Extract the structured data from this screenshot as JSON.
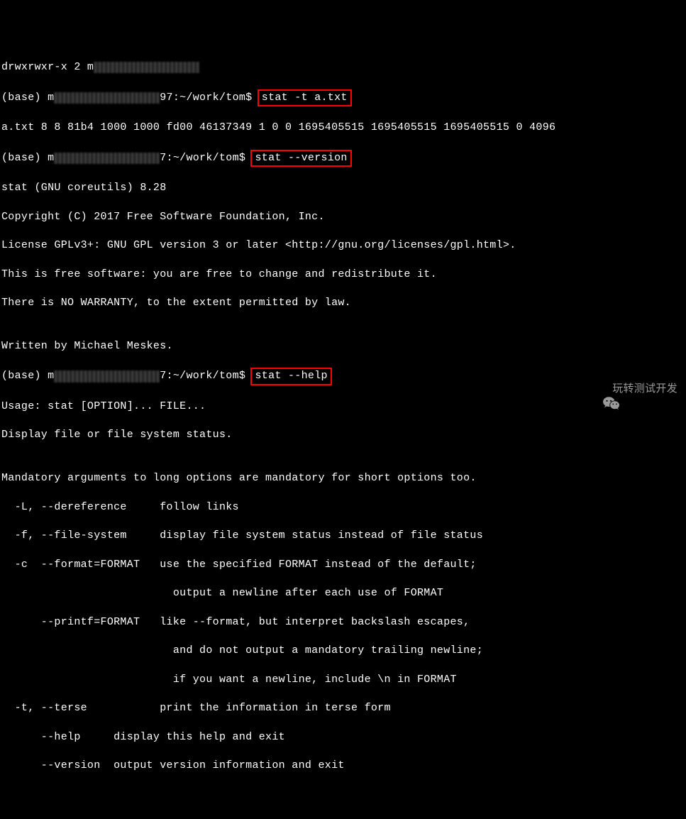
{
  "lines": {
    "l0_prefix": "drwxrwxr-x 2 m",
    "l0_suffix": "                                        ",
    "l1_prefix": "(base) m",
    "l1_mid": "97:~/work/tom$ ",
    "l1_cmd": "stat -t a.txt",
    "l2": "a.txt 8 8 81b4 1000 1000 fd00 46137349 1 0 0 1695405515 1695405515 1695405515 0 4096",
    "l3_prefix": "(base) m",
    "l3_mid": "7:~/work/tom$ ",
    "l3_cmd": "stat --version",
    "l4": "stat (GNU coreutils) 8.28",
    "l5": "Copyright (C) 2017 Free Software Foundation, Inc.",
    "l6": "License GPLv3+: GNU GPL version 3 or later <http://gnu.org/licenses/gpl.html>.",
    "l7": "This is free software: you are free to change and redistribute it.",
    "l8": "There is NO WARRANTY, to the extent permitted by law.",
    "l9": "",
    "l10": "Written by Michael Meskes.",
    "l11_prefix": "(base) m",
    "l11_mid": "7:~/work/tom$ ",
    "l11_cmd": "stat --help",
    "l12": "Usage: stat [OPTION]... FILE...",
    "l13": "Display file or file system status.",
    "l14": "",
    "l15": "Mandatory arguments to long options are mandatory for short options too.",
    "l16": "  -L, --dereference     follow links",
    "l17": "  -f, --file-system     display file system status instead of file status",
    "l18": "  -c  --format=FORMAT   use the specified FORMAT instead of the default;",
    "l19": "                          output a newline after each use of FORMAT",
    "l20": "      --printf=FORMAT   like --format, but interpret backslash escapes,",
    "l21": "                          and do not output a mandatory trailing newline;",
    "l22": "                          if you want a newline, include \\n in FORMAT",
    "l23": "  -t, --terse           print the information in terse form",
    "l24": "      --help     display this help and exit",
    "l25": "      --version  output version information and exit"
  },
  "redacted_text": "xxxxxxxxxxxxxxxx",
  "watermark_text": "玩转测试开发"
}
